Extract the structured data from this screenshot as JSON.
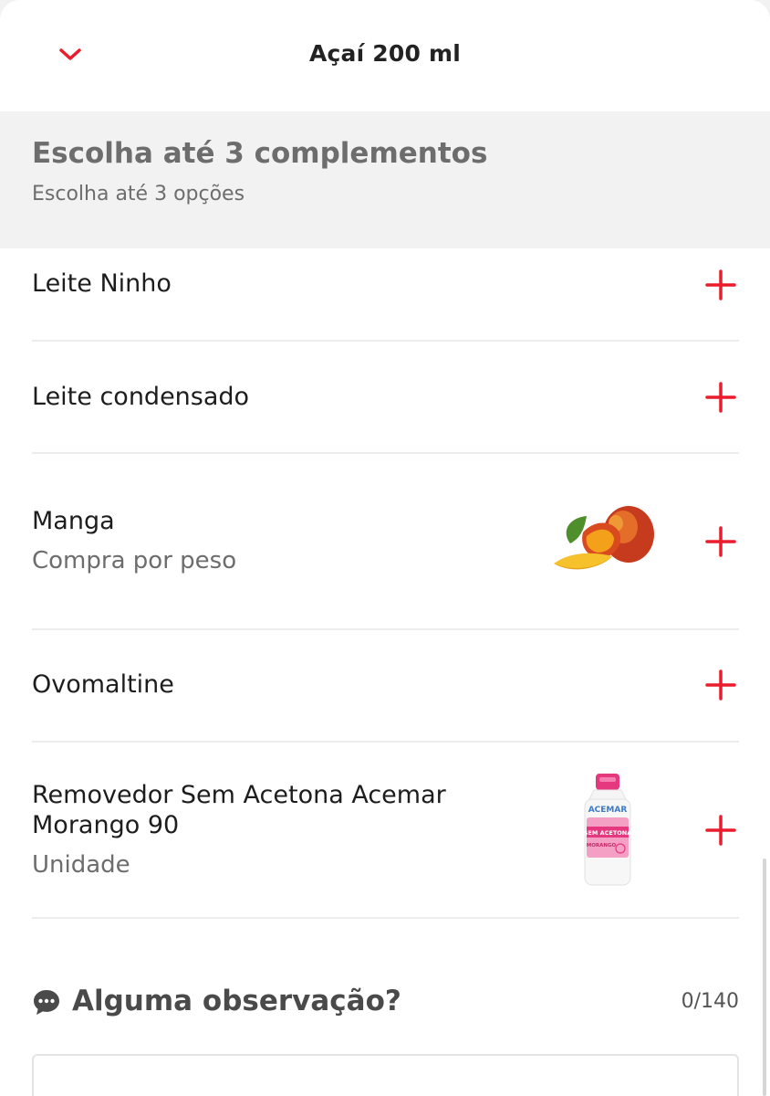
{
  "header": {
    "title": "Açaí 200 ml",
    "back_icon": "chevron-down-icon",
    "accent_color": "#ea1d2c"
  },
  "group": {
    "title": "Escolha até 3 complementos",
    "subtitle": "Escolha até 3 opções"
  },
  "items": [
    {
      "name": "Leite Ninho",
      "subtitle": "",
      "image": ""
    },
    {
      "name": "Leite condensado",
      "subtitle": "",
      "image": ""
    },
    {
      "name": "Manga",
      "subtitle": "Compra por peso",
      "image": "mango-image"
    },
    {
      "name": "Ovomaltine",
      "subtitle": "",
      "image": ""
    },
    {
      "name_line1": "Removedor Sem Acetona Acemar",
      "name_line2": "Morango 90",
      "subtitle": "Unidade",
      "image": "acemar-bottle-image",
      "bottle_brand": "ACEMAR",
      "bottle_label": "SEM ACETONA",
      "bottle_flavor": "MORANGO"
    }
  ],
  "observation": {
    "icon": "chat-bubble-icon",
    "title": "Alguma observação?",
    "counter": "0/140",
    "placeholder": ""
  }
}
